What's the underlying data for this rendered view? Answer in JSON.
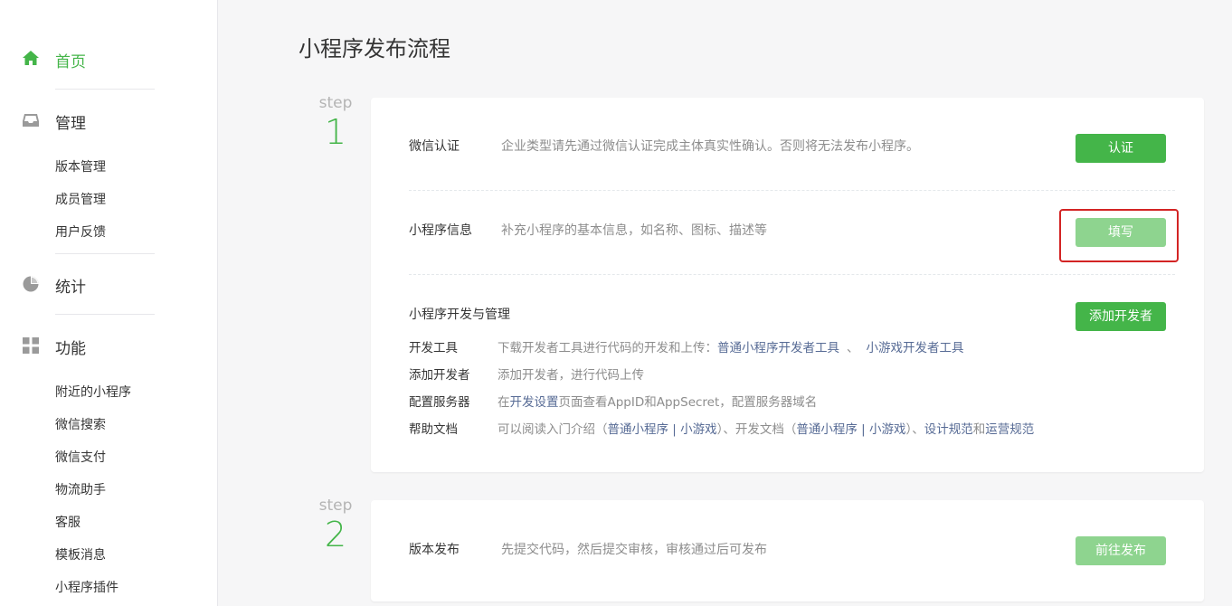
{
  "sidebar": {
    "home": {
      "label": "首页",
      "icon": "home-icon"
    },
    "manage": {
      "label": "管理",
      "icon": "inbox-icon",
      "items": [
        "版本管理",
        "成员管理",
        "用户反馈"
      ]
    },
    "stats": {
      "label": "统计",
      "icon": "pie-chart-icon"
    },
    "features": {
      "label": "功能",
      "icon": "grid-icon",
      "items": [
        "附近的小程序",
        "微信搜索",
        "微信支付",
        "物流助手",
        "客服",
        "模板消息",
        "小程序插件"
      ]
    }
  },
  "page": {
    "title": "小程序发布流程"
  },
  "steps": [
    {
      "label": "step",
      "number": "1",
      "rows": {
        "verify": {
          "label": "微信认证",
          "desc": "企业类型请先通过微信认证完成主体真实性确认。否则将无法发布小程序。",
          "button": "认证"
        },
        "info": {
          "label": "小程序信息",
          "desc": "补充小程序的基本信息，如名称、图标、描述等",
          "button": "填写"
        },
        "dev": {
          "label": "小程序开发与管理",
          "button": "添加开发者",
          "tools": {
            "label": "开发工具",
            "desc": "下载开发者工具进行代码的开发和上传：",
            "link1": "普通小程序开发者工具",
            "sep": "、",
            "link2": "小游戏开发者工具"
          },
          "add_dev": {
            "label": "添加开发者",
            "desc": "添加开发者，进行代码上传"
          },
          "server": {
            "label": "配置服务器",
            "desc_pre": "在",
            "link": "开发设置",
            "desc_post": "页面查看AppID和AppSecret，配置服务器域名"
          },
          "docs": {
            "label": "帮助文档",
            "p1": "可以阅读入门介绍（",
            "l1": "普通小程序",
            "p2": " | ",
            "l2": "小游戏",
            "p3": "）、开发文档（",
            "l3": "普通小程序",
            "p4": " | ",
            "l4": "小游戏",
            "p5": "）、",
            "l5": "设计规范",
            "p6": "和",
            "l6": "运营规范"
          }
        }
      }
    },
    {
      "label": "step",
      "number": "2",
      "rows": {
        "publish": {
          "label": "版本发布",
          "desc": "先提交代码，然后提交审核，审核通过后可发布",
          "button": "前往发布"
        }
      }
    }
  ],
  "colors": {
    "accent": "#44b549",
    "accent_disabled": "#8ed48f",
    "link": "#576b95",
    "highlight": "#d32424"
  }
}
